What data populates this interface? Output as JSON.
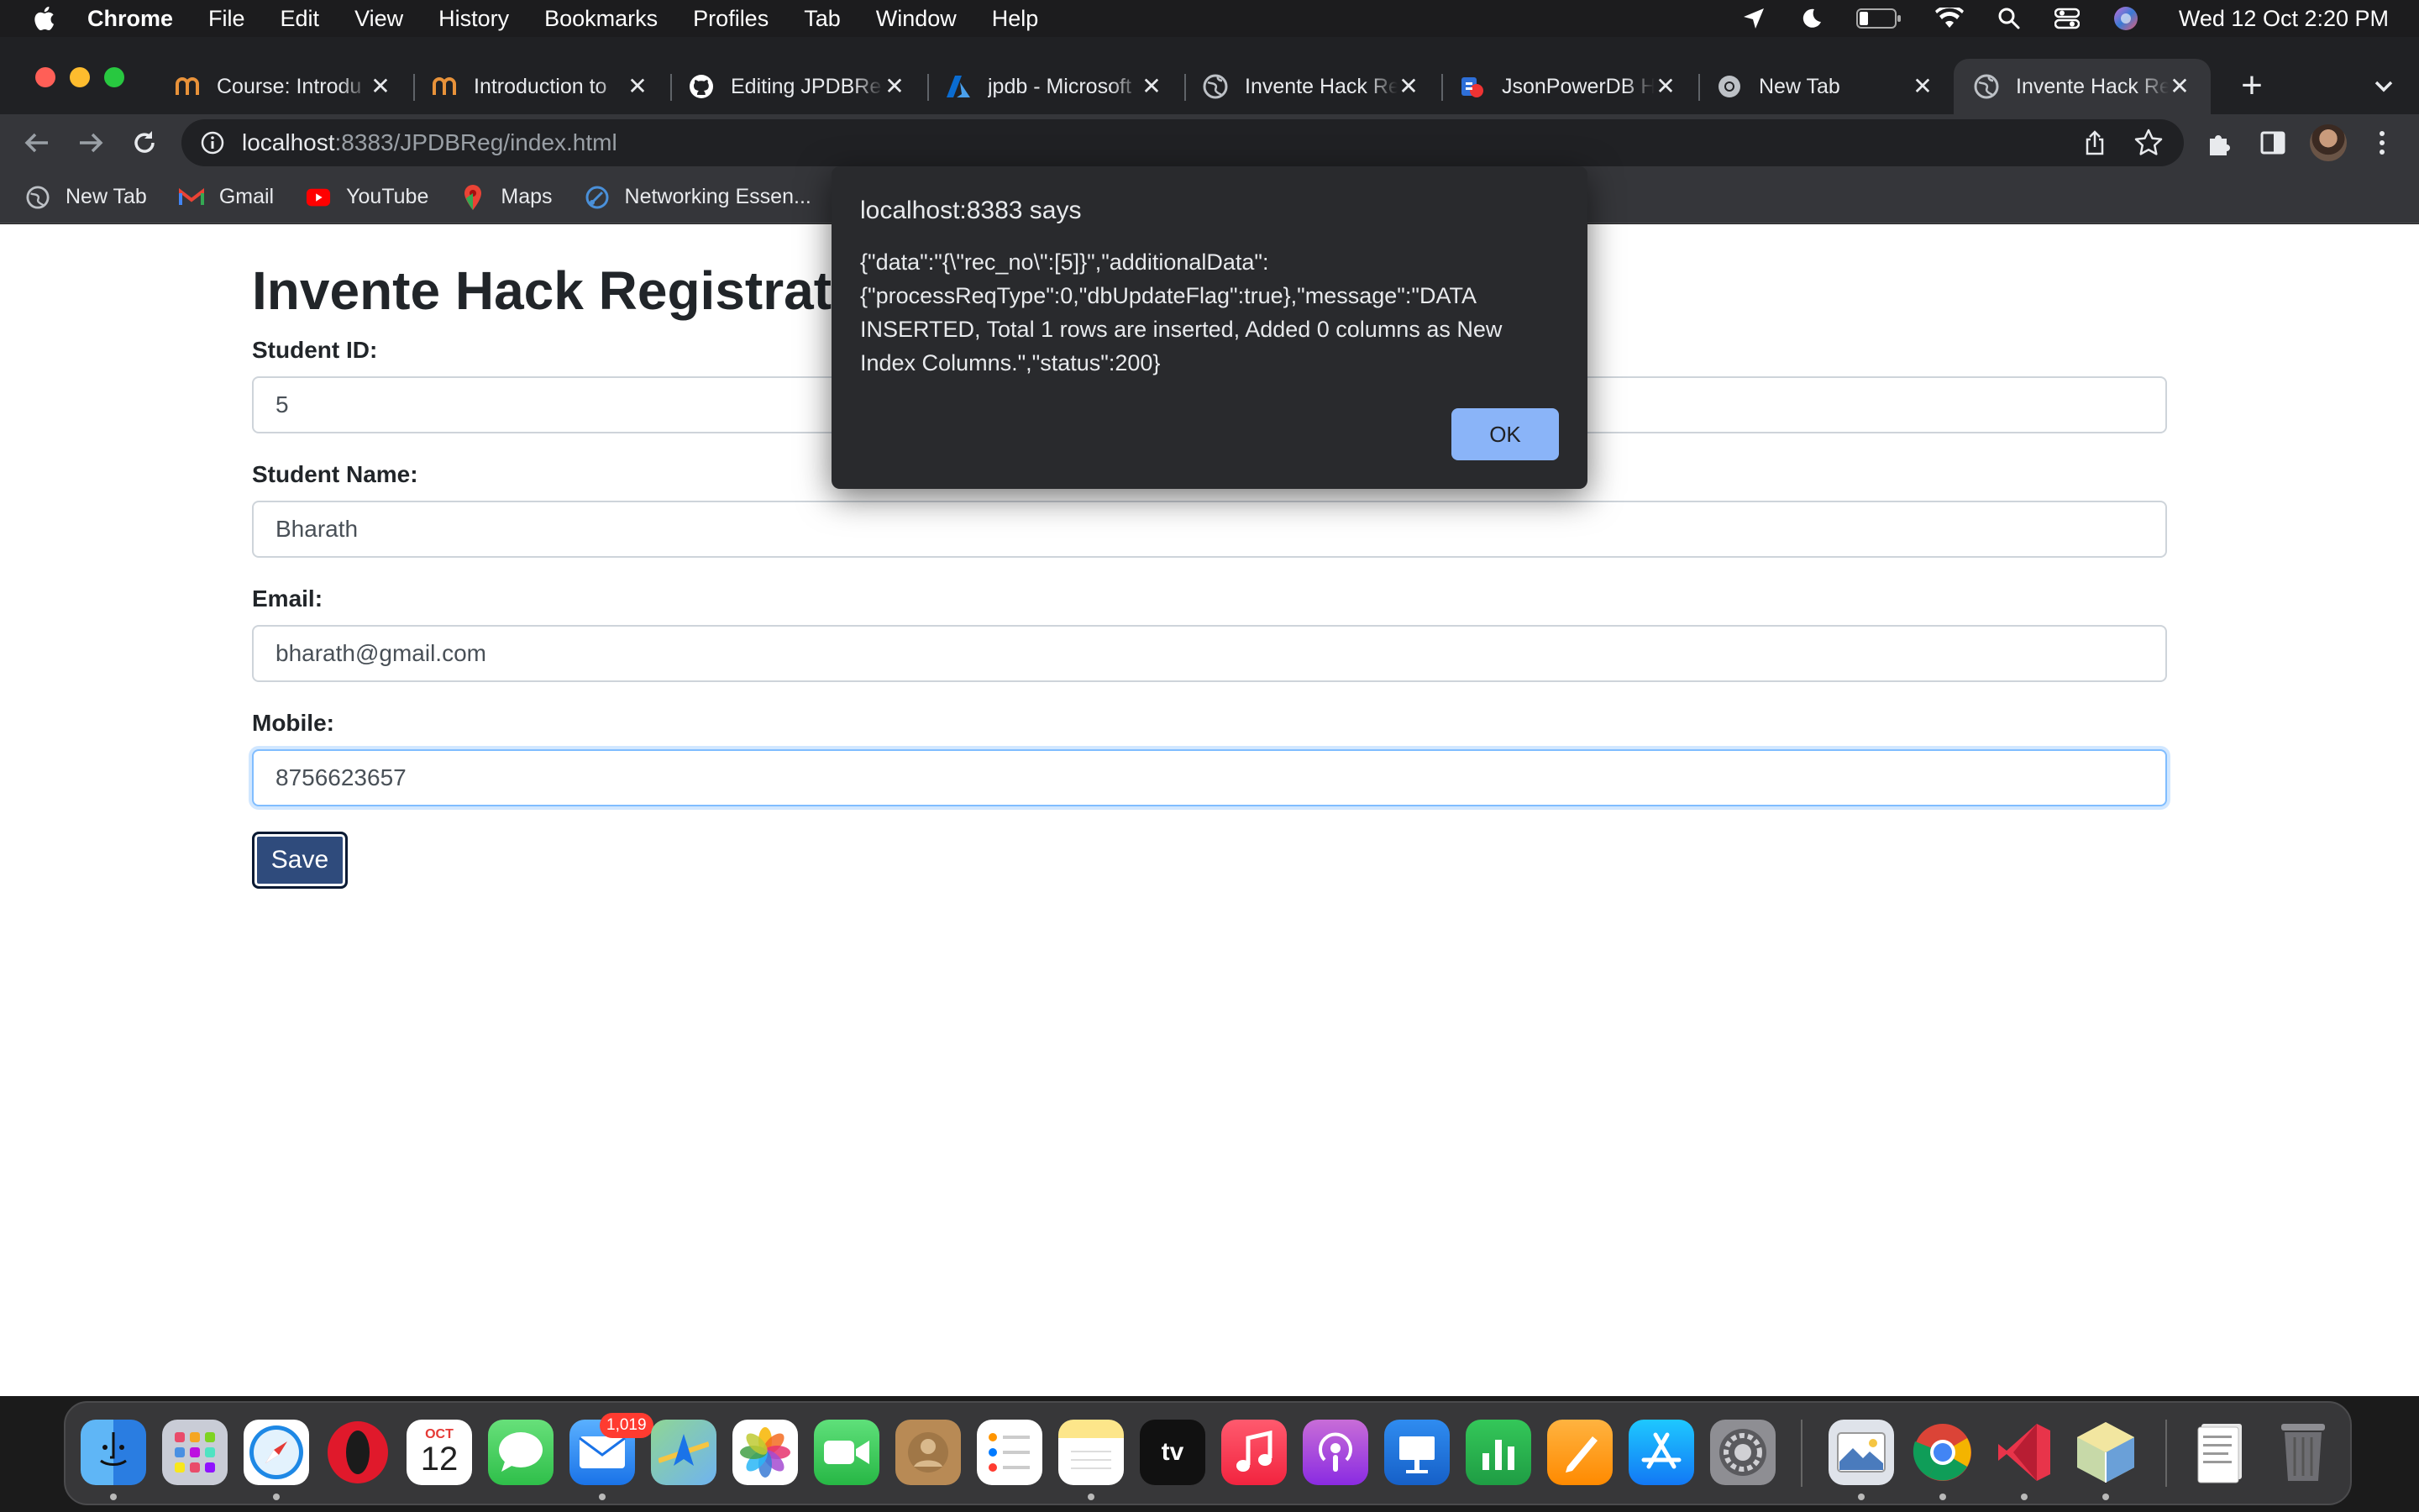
{
  "menubar": {
    "app_name": "Chrome",
    "items": [
      "File",
      "Edit",
      "View",
      "History",
      "Bookmarks",
      "Profiles",
      "Tab",
      "Window",
      "Help"
    ],
    "clock": "Wed 12 Oct  2:20 PM"
  },
  "tabs": [
    {
      "title": "Course: Introdu",
      "icon": "nptel-icon"
    },
    {
      "title": "Introduction to",
      "icon": "nptel-icon"
    },
    {
      "title": "Editing JPDBRe",
      "icon": "github-icon"
    },
    {
      "title": "jpdb - Microsoft",
      "icon": "azure-icon"
    },
    {
      "title": "Invente Hack Re",
      "icon": "globe-icon"
    },
    {
      "title": "JsonPowerDB H",
      "icon": "jsonpowerdb-icon"
    },
    {
      "title": "New Tab",
      "icon": "chrome-icon"
    },
    {
      "title": "Invente Hack Re",
      "icon": "globe-icon",
      "active": true
    }
  ],
  "omnibox": {
    "host": "localhost",
    "path": ":8383/JPDBReg/index.html"
  },
  "bookmarks": [
    {
      "label": "New Tab",
      "icon": "globe-icon"
    },
    {
      "label": "Gmail",
      "icon": "gmail-icon"
    },
    {
      "label": "YouTube",
      "icon": "youtube-icon"
    },
    {
      "label": "Maps",
      "icon": "maps-icon"
    },
    {
      "label": "Networking Essen...",
      "icon": "networking-icon"
    }
  ],
  "page": {
    "heading": "Invente Hack Registration",
    "fields": {
      "student_id": {
        "label": "Student ID:",
        "value": "5"
      },
      "student_name": {
        "label": "Student Name:",
        "value": "Bharath"
      },
      "email": {
        "label": "Email:",
        "value": "bharath@gmail.com"
      },
      "mobile": {
        "label": "Mobile:",
        "value": "8756623657"
      }
    },
    "save_label": "Save"
  },
  "dialog": {
    "title": "localhost:8383 says",
    "message": "{\"data\":\"{\\\"rec_no\\\":[5]}\",\"additionalData\":{\"processReqType\":0,\"dbUpdateFlag\":true},\"message\":\"DATA INSERTED, Total 1 rows are inserted, Added 0 columns as New Index Columns.\",\"status\":200}",
    "ok_label": "OK"
  },
  "dock": {
    "apps": [
      "Finder",
      "Launchpad",
      "Safari",
      "Opera",
      "Calendar",
      "Messages",
      "Mail",
      "Maps",
      "Photos",
      "FaceTime",
      "Contacts",
      "Reminders",
      "Notes",
      "TV",
      "Music",
      "Podcasts",
      "Keynote",
      "Numbers",
      "Pages",
      "App Store",
      "System Preferences",
      "Preview",
      "Chrome",
      "VS Code",
      "NetBeans",
      "Documents",
      "Trash"
    ],
    "calendar_month": "OCT",
    "calendar_day": "12",
    "tv_label": "tv",
    "mail_badge": "1,019"
  },
  "colors": {
    "menubar_bg": "#1c1c1e",
    "tabstrip_bg": "#202124",
    "toolbar_bg": "#35363a",
    "dialog_bg": "#292a2d",
    "ok_button": "#8ab4f8",
    "save_button": "#2f4b7c",
    "page_bg": "#ffffff"
  }
}
